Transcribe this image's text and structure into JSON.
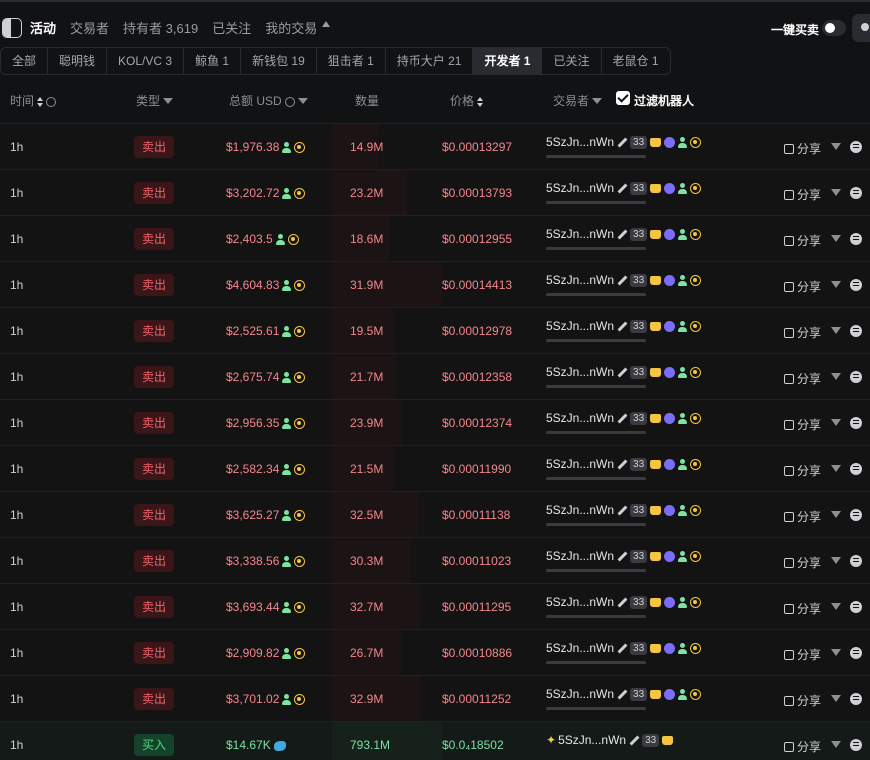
{
  "top_tabs": {
    "activity": "活动",
    "traders": "交易者",
    "holders": "持有者 3,619",
    "followed": "已关注",
    "my_trades": "我的交易"
  },
  "quick_trade_label": "一键买卖",
  "filter_tabs": [
    "全部",
    "聪明钱",
    "KOL/VC 3",
    "鲸鱼 1",
    "新钱包 19",
    "狙击者 1",
    "持币大户 21",
    "开发者 1",
    "已关注",
    "老鼠仓 1"
  ],
  "active_filter_tab": "开发者 1",
  "columns": {
    "time": "时间",
    "type": "类型",
    "total": "总额 USD",
    "amount": "数量",
    "price": "价格",
    "trader": "交易者",
    "filter_bots": "过滤机器人"
  },
  "filter_bots_checked": true,
  "share_label": "分享",
  "trades": [
    {
      "time": "1h",
      "type": "卖出",
      "side": "sell",
      "total": "$1,976.38",
      "amount": "14.9M",
      "price": "$0.00013297",
      "trader": "5SzJn...nWn",
      "tx_count": "33",
      "bar_pct": 43
    },
    {
      "time": "1h",
      "type": "卖出",
      "side": "sell",
      "total": "$3,202.72",
      "amount": "23.2M",
      "price": "$0.00013793",
      "trader": "5SzJn...nWn",
      "tx_count": "33",
      "bar_pct": 68
    },
    {
      "time": "1h",
      "type": "卖出",
      "side": "sell",
      "total": "$2,403.5",
      "amount": "18.6M",
      "price": "$0.00012955",
      "trader": "5SzJn...nWn",
      "tx_count": "33",
      "bar_pct": 52
    },
    {
      "time": "1h",
      "type": "卖出",
      "side": "sell",
      "total": "$4,604.83",
      "amount": "31.9M",
      "price": "$0.00014413",
      "trader": "5SzJn...nWn",
      "tx_count": "33",
      "bar_pct": 100
    },
    {
      "time": "1h",
      "type": "卖出",
      "side": "sell",
      "total": "$2,525.61",
      "amount": "19.5M",
      "price": "$0.00012978",
      "trader": "5SzJn...nWn",
      "tx_count": "33",
      "bar_pct": 55
    },
    {
      "time": "1h",
      "type": "卖出",
      "side": "sell",
      "total": "$2,675.74",
      "amount": "21.7M",
      "price": "$0.00012358",
      "trader": "5SzJn...nWn",
      "tx_count": "33",
      "bar_pct": 58
    },
    {
      "time": "1h",
      "type": "卖出",
      "side": "sell",
      "total": "$2,956.35",
      "amount": "23.9M",
      "price": "$0.00012374",
      "trader": "5SzJn...nWn",
      "tx_count": "33",
      "bar_pct": 64
    },
    {
      "time": "1h",
      "type": "卖出",
      "side": "sell",
      "total": "$2,582.34",
      "amount": "21.5M",
      "price": "$0.00011990",
      "trader": "5SzJn...nWn",
      "tx_count": "33",
      "bar_pct": 56
    },
    {
      "time": "1h",
      "type": "卖出",
      "side": "sell",
      "total": "$3,625.27",
      "amount": "32.5M",
      "price": "$0.00011138",
      "trader": "5SzJn...nWn",
      "tx_count": "33",
      "bar_pct": 79
    },
    {
      "time": "1h",
      "type": "卖出",
      "side": "sell",
      "total": "$3,338.56",
      "amount": "30.3M",
      "price": "$0.00011023",
      "trader": "5SzJn...nWn",
      "tx_count": "33",
      "bar_pct": 72
    },
    {
      "time": "1h",
      "type": "卖出",
      "side": "sell",
      "total": "$3,693.44",
      "amount": "32.7M",
      "price": "$0.00011295",
      "trader": "5SzJn...nWn",
      "tx_count": "33",
      "bar_pct": 80
    },
    {
      "time": "1h",
      "type": "卖出",
      "side": "sell",
      "total": "$2,909.82",
      "amount": "26.7M",
      "price": "$0.00010886",
      "trader": "5SzJn...nWn",
      "tx_count": "33",
      "bar_pct": 63
    },
    {
      "time": "1h",
      "type": "卖出",
      "side": "sell",
      "total": "$3,701.02",
      "amount": "32.9M",
      "price": "$0.00011252",
      "trader": "5SzJn...nWn",
      "tx_count": "33",
      "bar_pct": 80
    },
    {
      "time": "1h",
      "type": "买入",
      "side": "buy",
      "total": "$14.67K",
      "amount": "793.1M",
      "price": "$0.0₄18502",
      "trader": "5SzJn...nWn",
      "tx_count": "33",
      "bar_pct": 100
    }
  ]
}
